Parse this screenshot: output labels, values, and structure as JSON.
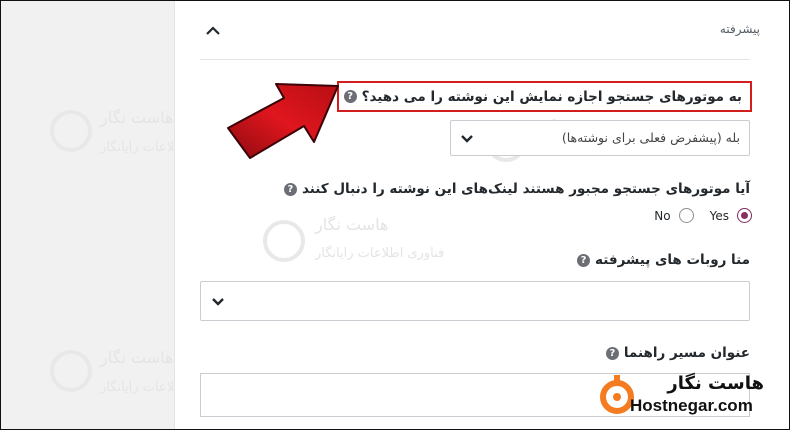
{
  "section": {
    "title": "پیشرفته"
  },
  "fields": {
    "allow_search": {
      "label": "به موتورهای جستجو اجازه نمایش این نوشته را می دهید؟",
      "selected": "بله (پیشفرض فعلی برای نوشته‌ها)"
    },
    "follow_links": {
      "label": "آیا موتورهای جستجو مجبور هستند لینک‌های این نوشته را دنبال کنند",
      "options": [
        "Yes",
        "No"
      ],
      "selected": "Yes"
    },
    "meta_robots": {
      "label": "متا روبات های پیشرفته",
      "selected": ""
    },
    "breadcrumb_title": {
      "label": "عنوان مسیر راهنما",
      "value": ""
    }
  },
  "help_glyph": "?",
  "watermark": {
    "line1": "هاست نگار",
    "line2": "فناوری اطلاعات رایانگار"
  },
  "logo": {
    "title": "هاست نگار",
    "name": "Hostnegar.com"
  },
  "colors": {
    "highlight": "#d31e1e",
    "arrow": "#d0141b",
    "radio_selected": "#8a2d63",
    "logo_orange": "#f47b20"
  }
}
